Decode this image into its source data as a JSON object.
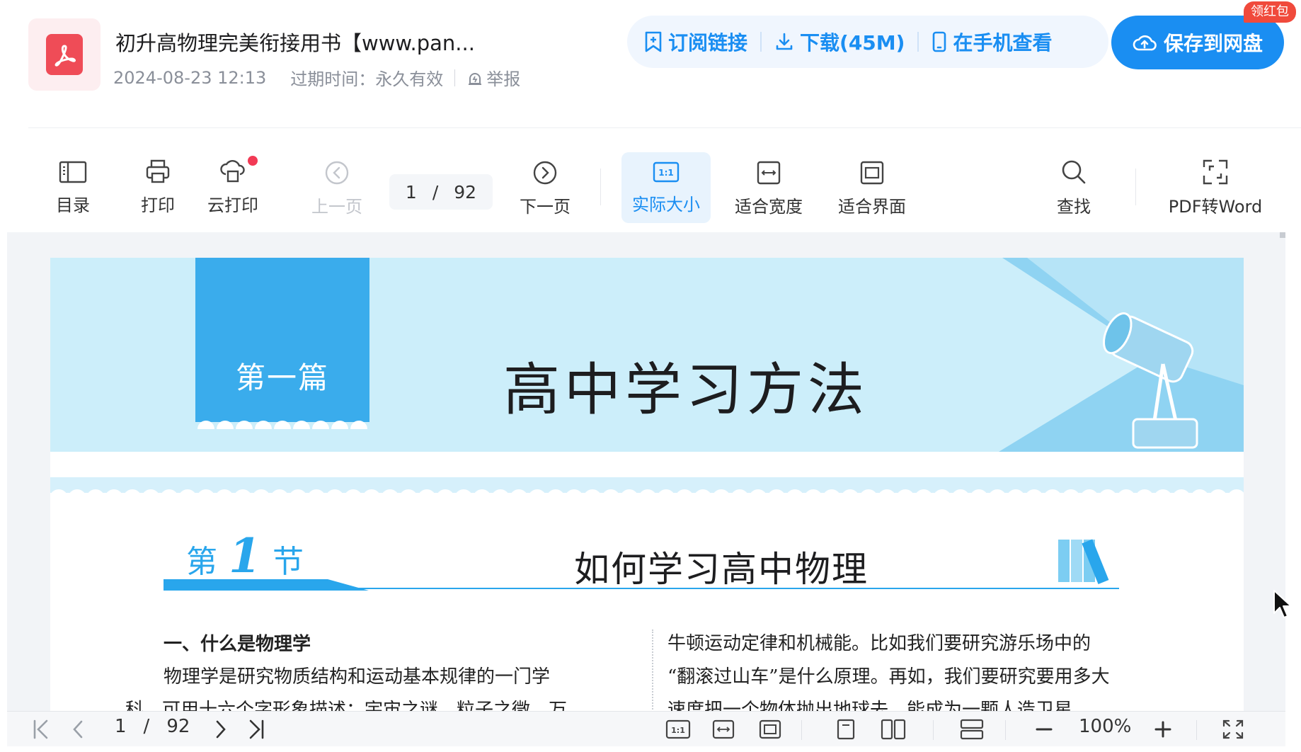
{
  "header": {
    "title": "初升高物理完美衔接用书【www.pan...",
    "date": "2024-08-23 12:13",
    "expiry": "过期时间：永久有效",
    "report_label": "举报"
  },
  "actions": {
    "subscribe": "订阅链接",
    "download": "下载(45M)",
    "mobile": "在手机查看",
    "save": "保存到网盘",
    "red_packet": "领红包"
  },
  "toolbar": {
    "toc": "目录",
    "print": "打印",
    "cloud_print": "云打印",
    "prev": "上一页",
    "current_page": "1",
    "page_sep": "/",
    "total_pages": "92",
    "next": "下一页",
    "actual_size": "实际大小",
    "fit_width": "适合宽度",
    "fit_view": "适合界面",
    "search": "查找",
    "pdf_to_word": "PDF转Word"
  },
  "document": {
    "part_label": "第一篇",
    "part_title": "高中学习方法",
    "section_prefix": "第",
    "section_number": "1",
    "section_suffix": "节",
    "section_title": "如何学习高中物理",
    "left_heading": "一、什么是物理学",
    "left_line1": "物理学是研究物质结构和运动基本规律的一门学",
    "left_line2": "科，可用十六个字形象描述：宇宙之谜，粒子之微，万",
    "right_line1": "牛顿运动定律和机械能。比如我们要研究游乐场中的",
    "right_line2": "“翻滚过山车”是什么原理。再如，我们要研究要用多大",
    "right_line3": "速度把一个物体抛出地球去，能成为一颗人造卫星"
  },
  "bottom_bar": {
    "current_page": "1",
    "page_sep": "/",
    "total_pages": "92",
    "zoom": "100%"
  },
  "colors": {
    "accent": "#1a8ef2",
    "banner_bg": "#cceefa",
    "section_blue": "#29a6ec",
    "pdf_red": "#ef4c57"
  }
}
